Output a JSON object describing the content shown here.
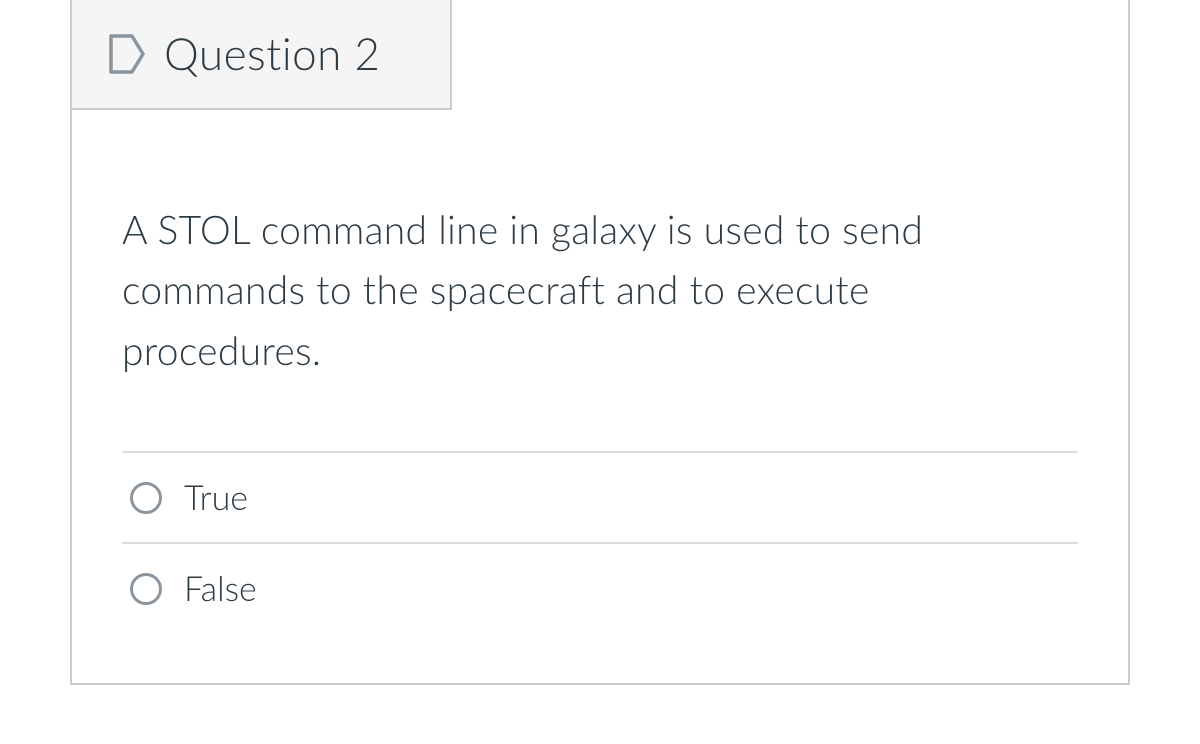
{
  "question": {
    "title": "Question 2",
    "text": "A STOL command line in galaxy is used to send commands to the spacecraft and to execute procedures.",
    "options": [
      {
        "label": "True"
      },
      {
        "label": "False"
      }
    ]
  }
}
